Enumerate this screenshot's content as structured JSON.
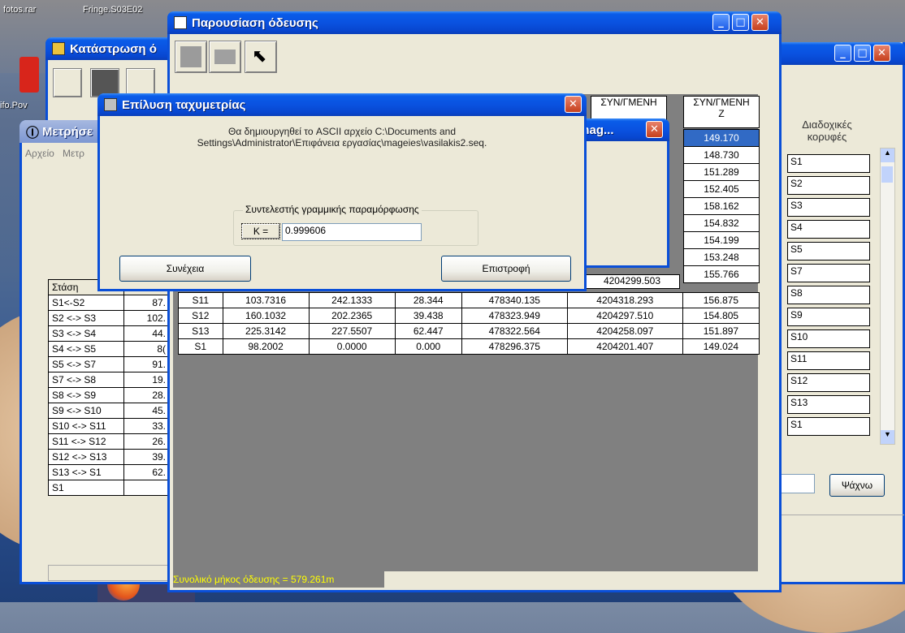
{
  "desktop": {
    "icon_labels": [
      "fotos.rar",
      "Fringe.S03E02",
      "ifo.Pov"
    ]
  },
  "win_katastrosi": {
    "title": "Κατάστρωση ό"
  },
  "win_metriseis": {
    "title": "Μετρήσε",
    "menu": [
      "Αρχείο",
      "Μετρ"
    ],
    "table_header": "Στάση",
    "rows": [
      {
        "name": "S1<-S2",
        "value": "87."
      },
      {
        "name": "S2 <-> S3",
        "value": "102."
      },
      {
        "name": "S3 <-> S4",
        "value": "44."
      },
      {
        "name": "S4 <-> S5",
        "value": "8("
      },
      {
        "name": "S5 <-> S7",
        "value": "91."
      },
      {
        "name": "S7 <-> S8",
        "value": "19."
      },
      {
        "name": "S8 <-> S9",
        "value": "28."
      },
      {
        "name": "S9 <-> S10",
        "value": "45."
      },
      {
        "name": "S10 <-> S11",
        "value": "33."
      },
      {
        "name": "S11 <-> S12",
        "value": "26."
      },
      {
        "name": "S12 <-> S13",
        "value": "39."
      },
      {
        "name": "S13 <-> S1",
        "value": "62."
      },
      {
        "name": "S1",
        "value": ""
      }
    ]
  },
  "win_right": {
    "label_line1": "Διαδοχικές",
    "label_line2": "κορυφές",
    "list": [
      "S1",
      "S2",
      "S3",
      "S4",
      "S5",
      "S7",
      "S8",
      "S9",
      "S10",
      "S11",
      "S12",
      "S13",
      "S1"
    ],
    "search_button": "Ψάχνω"
  },
  "win_parousiasi": {
    "title": "Παρουσίαση όδευσης",
    "col_headers": [
      {
        "l1": "ΣΥΝ/ΓΜΕΝΗ",
        "l2": ""
      },
      {
        "l1": "ΣΥΝ/ΓΜΕΝΗ",
        "l2": "Z"
      }
    ],
    "z_column": [
      "149.170",
      "148.730",
      "151.289",
      "152.405",
      "158.162",
      "154.832",
      "154.199",
      "153.248",
      "155.766"
    ],
    "partial_row": {
      "c5": "4204299.503"
    },
    "rows": [
      {
        "c1": "S11",
        "c2": "103.7316",
        "c3": "242.1333",
        "c4": "28.344",
        "c5": "478340.135",
        "c6": "4204318.293",
        "c7": "156.875"
      },
      {
        "c1": "S12",
        "c2": "160.1032",
        "c3": "202.2365",
        "c4": "39.438",
        "c5": "478323.949",
        "c6": "4204297.510",
        "c7": "154.805"
      },
      {
        "c1": "S13",
        "c2": "225.3142",
        "c3": "227.5507",
        "c4": "62.447",
        "c5": "478322.564",
        "c6": "4204258.097",
        "c7": "151.897"
      },
      {
        "c1": "S1",
        "c2": "98.2002",
        "c3": "0.0000",
        "c4": "0.000",
        "c5": "478296.375",
        "c6": "4204201.407",
        "c7": "149.024"
      }
    ],
    "status": "Συνολικό μήκος όδευσης = 579.261m"
  },
  "win_behind_dialog": {
    "title": "\\mag..."
  },
  "dialog": {
    "title": "Επίλυση ταχυμετρίας",
    "message_line1": "Θα δημιουργηθεί το ASCII αρχείο C:\\Documents and",
    "message_line2": "Settings\\Administrator\\Επιφάνεια εργασίας\\mageies\\vasilakis2.seq.",
    "group_label": "Συντελεστής γραμμικής παραμόρφωσης",
    "k_button": "K =",
    "k_value": "0.999606",
    "continue_button": "Συνέχεια",
    "return_button": "Επιστροφή"
  }
}
